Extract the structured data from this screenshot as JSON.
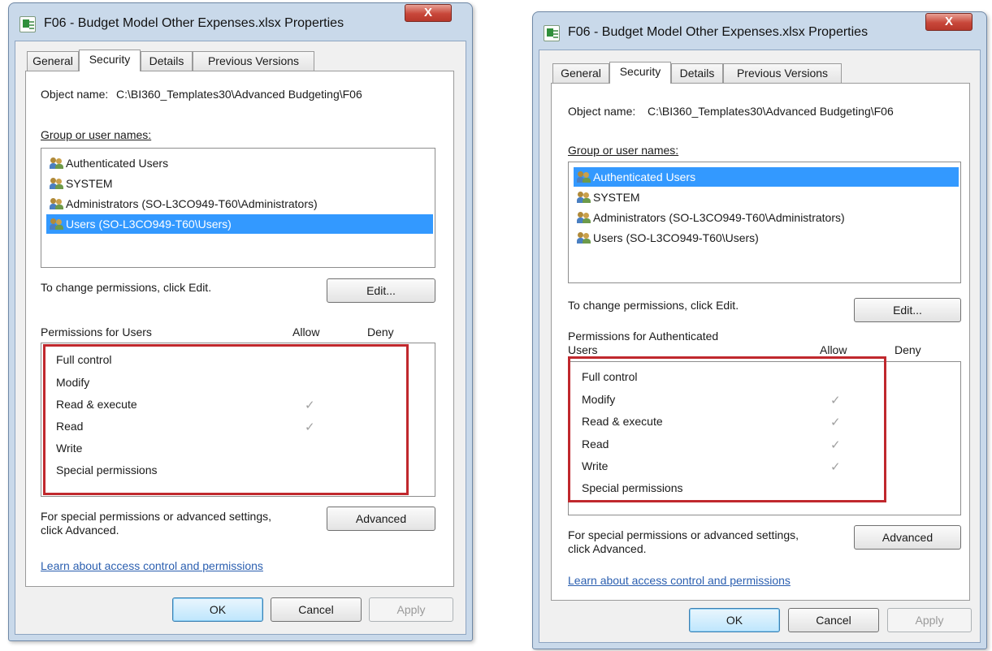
{
  "dialogs": [
    {
      "title": "F06 - Budget Model Other Expenses.xlsx Properties",
      "close_label": "X",
      "tabs": [
        "General",
        "Security",
        "Details",
        "Previous Versions"
      ],
      "active_tab": "Security",
      "object_name_label": "Object name:",
      "object_name_value": "C:\\BI360_Templates30\\Advanced Budgeting\\F06",
      "group_label": "Group or user names:",
      "users": [
        "Authenticated Users",
        "SYSTEM",
        "Administrators (SO-L3CO949-T60\\Administrators)",
        "Users (SO-L3CO949-T60\\Users)"
      ],
      "selected_user": "Users (SO-L3CO949-T60\\Users)",
      "change_text": "To change permissions, click Edit.",
      "edit_label": "Edit...",
      "permissions_for_line1": "Permissions for Users",
      "permissions_for_line2": "",
      "allow_header": "Allow",
      "deny_header": "Deny",
      "permissions": [
        "Full control",
        "Modify",
        "Read & execute",
        "Read",
        "Write",
        "Special permissions"
      ],
      "allow_checks": [
        false,
        false,
        true,
        true,
        false,
        false
      ],
      "check_glyph": "✓",
      "special_text_line1": "For special permissions or advanced settings,",
      "special_text_line2": "click Advanced.",
      "advanced_label": "Advanced",
      "learn_link": "Learn about access control and permissions",
      "ok_label": "OK",
      "cancel_label": "Cancel",
      "apply_label": "Apply",
      "highlight_color": "#c0282d",
      "selection_color": "#3399ff"
    },
    {
      "title": "F06 - Budget Model Other Expenses.xlsx Properties",
      "close_label": "X",
      "tabs": [
        "General",
        "Security",
        "Details",
        "Previous Versions"
      ],
      "active_tab": "Security",
      "object_name_label": "Object name:",
      "object_name_value": "C:\\BI360_Templates30\\Advanced Budgeting\\F06",
      "group_label": "Group or user names:",
      "users": [
        "Authenticated Users",
        "SYSTEM",
        "Administrators (SO-L3CO949-T60\\Administrators)",
        "Users (SO-L3CO949-T60\\Users)"
      ],
      "selected_user": "Authenticated Users",
      "change_text": "To change permissions, click Edit.",
      "edit_label": "Edit...",
      "permissions_for_line1": "Permissions for Authenticated",
      "permissions_for_line2": "Users",
      "allow_header": "Allow",
      "deny_header": "Deny",
      "permissions": [
        "Full control",
        "Modify",
        "Read & execute",
        "Read",
        "Write",
        "Special permissions"
      ],
      "allow_checks": [
        false,
        true,
        true,
        true,
        true,
        false
      ],
      "check_glyph": "✓",
      "special_text_line1": "For special permissions or advanced settings,",
      "special_text_line2": "click Advanced.",
      "advanced_label": "Advanced",
      "learn_link": "Learn about access control and permissions",
      "ok_label": "OK",
      "cancel_label": "Cancel",
      "apply_label": "Apply",
      "highlight_color": "#c0282d",
      "selection_color": "#3399ff"
    }
  ]
}
